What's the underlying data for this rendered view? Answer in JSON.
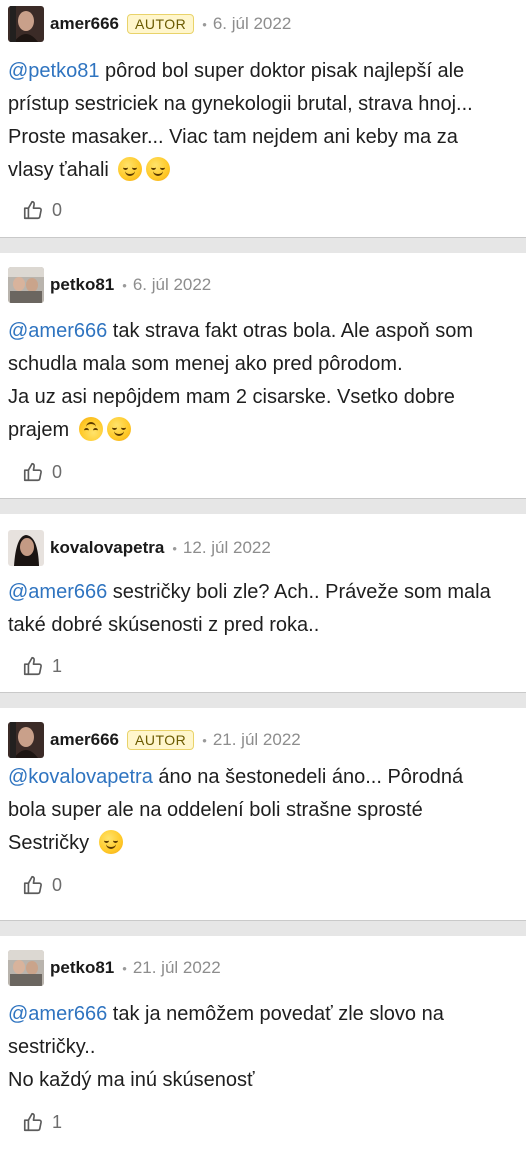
{
  "comments": [
    {
      "author": "amer666",
      "badge": "AUTOR",
      "date": "6. júl 2022",
      "mention": "@petko81",
      "lines": [
        " pôrod bol super doktor pisak najlepší ale",
        "prístup sestriciek na gynekologii brutal, strava hnoj...",
        "Proste masaker... Viac tam nejdem ani keby ma za",
        "vlasy ťahali"
      ],
      "emojis": [
        "smirking-face-emoji",
        "smirking-face-emoji"
      ],
      "likes": "0"
    },
    {
      "author": "petko81",
      "badge": "",
      "date": "6. júl 2022",
      "mention": "@amer666",
      "lines": [
        " tak strava fakt otras bola. Ale aspoň som",
        "schudla mala som menej ako pred pôrodom.",
        "Ja uz asi nepôjdem mam 2 cisarske. Vsetko dobre",
        "prajem"
      ],
      "emojis": [
        "upside-down-face-emoji",
        "smiling-face-emoji"
      ],
      "likes": "0"
    },
    {
      "author": "kovalovapetra",
      "badge": "",
      "date": "12. júl 2022",
      "mention": "@amer666",
      "lines": [
        " sestričky boli zle? Ach.. Práveže som mala",
        "také dobré skúsenosti z pred roka.."
      ],
      "emojis": [],
      "likes": "1"
    },
    {
      "author": "amer666",
      "badge": "AUTOR",
      "date": "21. júl 2022",
      "mention": "@kovalovapetra",
      "lines": [
        " áno na šestonedeli áno... Pôrodná",
        "bola super ale na oddelení boli strašne sprosté",
        "Sestričky"
      ],
      "emojis": [
        "smirking-face-emoji"
      ],
      "likes": "0"
    },
    {
      "author": "petko81",
      "badge": "",
      "date": "21. júl 2022",
      "mention": "@amer666",
      "lines": [
        " tak ja nemôžem povedať zle slovo na",
        "sestričky..",
        "No každý ma inú skúsenosť"
      ],
      "emojis": [],
      "likes": "1"
    }
  ],
  "colors": {
    "mention": "#2f74c0",
    "separator": "#e6e6e6",
    "badge_bg": "#fff6cc"
  },
  "icons": {
    "like": "thumbs-up-icon"
  }
}
